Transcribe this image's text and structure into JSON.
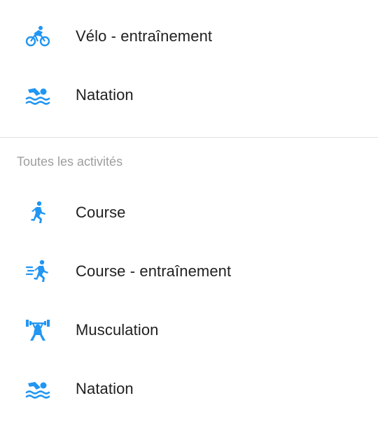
{
  "accent_color": "#2196F3",
  "recent_items": [
    {
      "label": "Vélo - entraînement",
      "icon": "cycling-icon"
    },
    {
      "label": "Natation",
      "icon": "swimming-icon"
    }
  ],
  "all_activities": {
    "header": "Toutes les activités",
    "items": [
      {
        "label": "Course",
        "icon": "running-icon"
      },
      {
        "label": "Course - entraînement",
        "icon": "running-training-icon"
      },
      {
        "label": "Musculation",
        "icon": "weightlifting-icon"
      },
      {
        "label": "Natation",
        "icon": "swimming-icon"
      }
    ]
  }
}
